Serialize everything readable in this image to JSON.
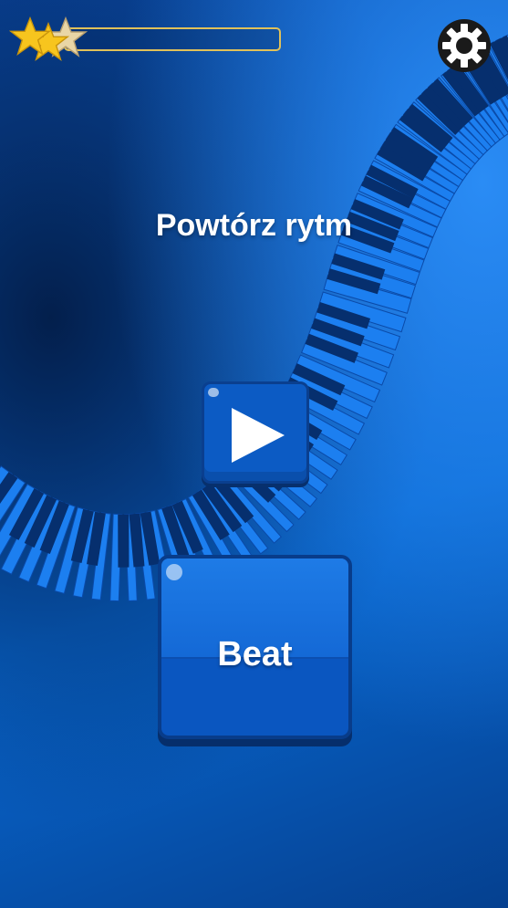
{
  "header": {
    "stars_total": 3,
    "stars_earned": 2,
    "progress": 0.0
  },
  "title": "Powtórz rytm",
  "play_button": {
    "icon": "play-icon"
  },
  "beat_button": {
    "label": "Beat"
  },
  "settings": {
    "icon": "gear-icon"
  },
  "colors": {
    "star_gold": "#f7c51e",
    "star_empty": "#e9d6a6",
    "progress_border": "#e0c15a",
    "button_blue": "#1469d6",
    "text": "#ffffff"
  }
}
